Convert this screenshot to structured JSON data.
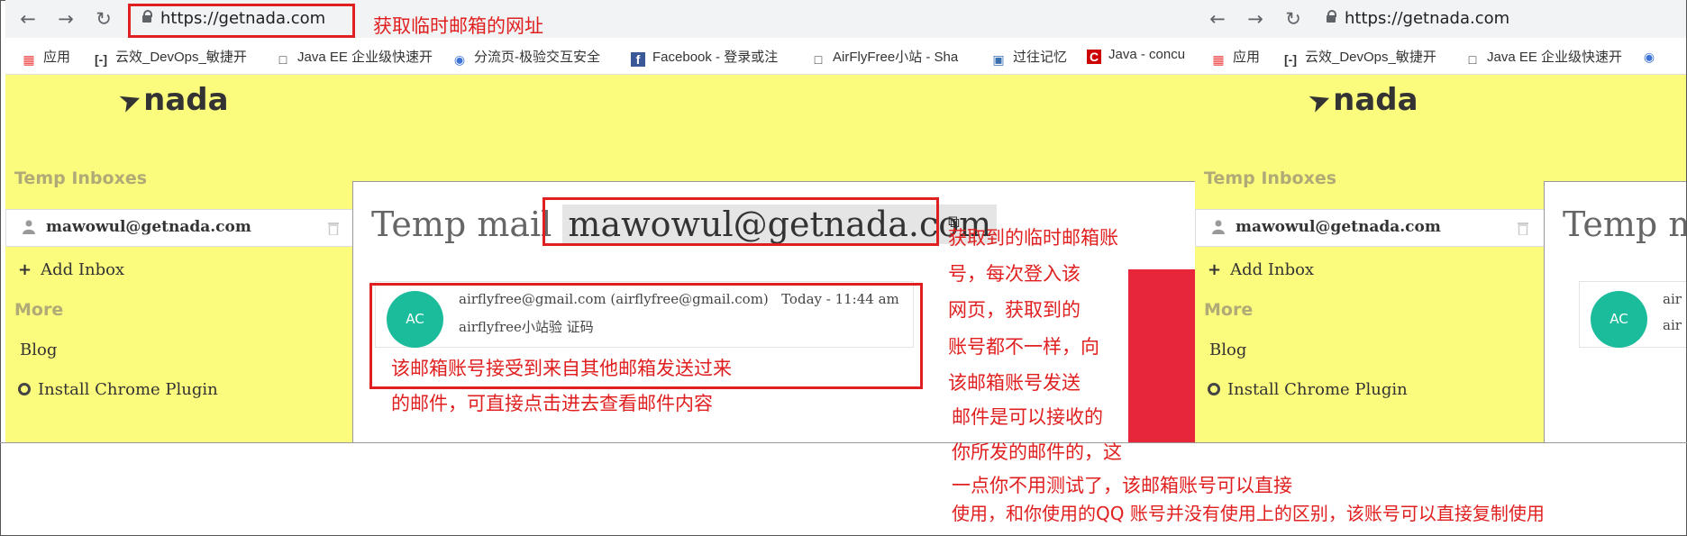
{
  "browser": {
    "url": "https://getnada.com",
    "bookmarks": [
      "应用",
      "云效_DevOps_敏捷开",
      "Java EE 企业级快速开",
      "分流页-极验交互安全",
      "Facebook - 登录或注",
      "AirFlyFree小站 - Sha",
      "过往记忆",
      "Java - concu"
    ],
    "bookmarks_right": [
      "应用",
      "云效_DevOps_敏捷开",
      "Java EE 企业级快速开"
    ]
  },
  "site": {
    "logo_text": "nada",
    "sidebar": {
      "temp_inboxes_heading": "Temp Inboxes",
      "inbox_address": "mawowul@getnada.com",
      "add_inbox_label": "Add Inbox",
      "more_heading": "More",
      "blog_label": "Blog",
      "chrome_plugin_label": "Install Chrome Plugin"
    },
    "main": {
      "title_prefix": "Temp mail",
      "title_prefix_right": "Temp m",
      "address": "mawowul@getnada.com",
      "email": {
        "avatar_initials": "AC",
        "from": "airflyfree@gmail.com (airflyfree@gmail.com)",
        "time": "Today - 11:44 am",
        "subject": "airflyfree小站验 证码",
        "from_right": "air",
        "subject_right": "air"
      }
    }
  },
  "annotations": {
    "url_note": "获取临时邮箱的网址",
    "email_note_1": "该邮箱账号接受到来自其他邮箱发送过来",
    "email_note_2": "的邮件，可直接点击进去查看邮件内容",
    "account_note": [
      "获取到的临时邮箱账",
      "号，每次登入该",
      "网页，获取到的",
      "账号都不一样，向",
      "该邮箱账号发送",
      "邮件是可以接收的",
      "你所发的邮件的，这",
      "一点你不用测试了，该邮箱账号可以直接",
      "使用，和你使用的QQ 账号并没有使用上的区别，该账号可以直接复制使用"
    ]
  },
  "colors": {
    "site_background": "#fbfb7e",
    "annotation_red": "#e02020",
    "avatar": "#1abc9c"
  }
}
